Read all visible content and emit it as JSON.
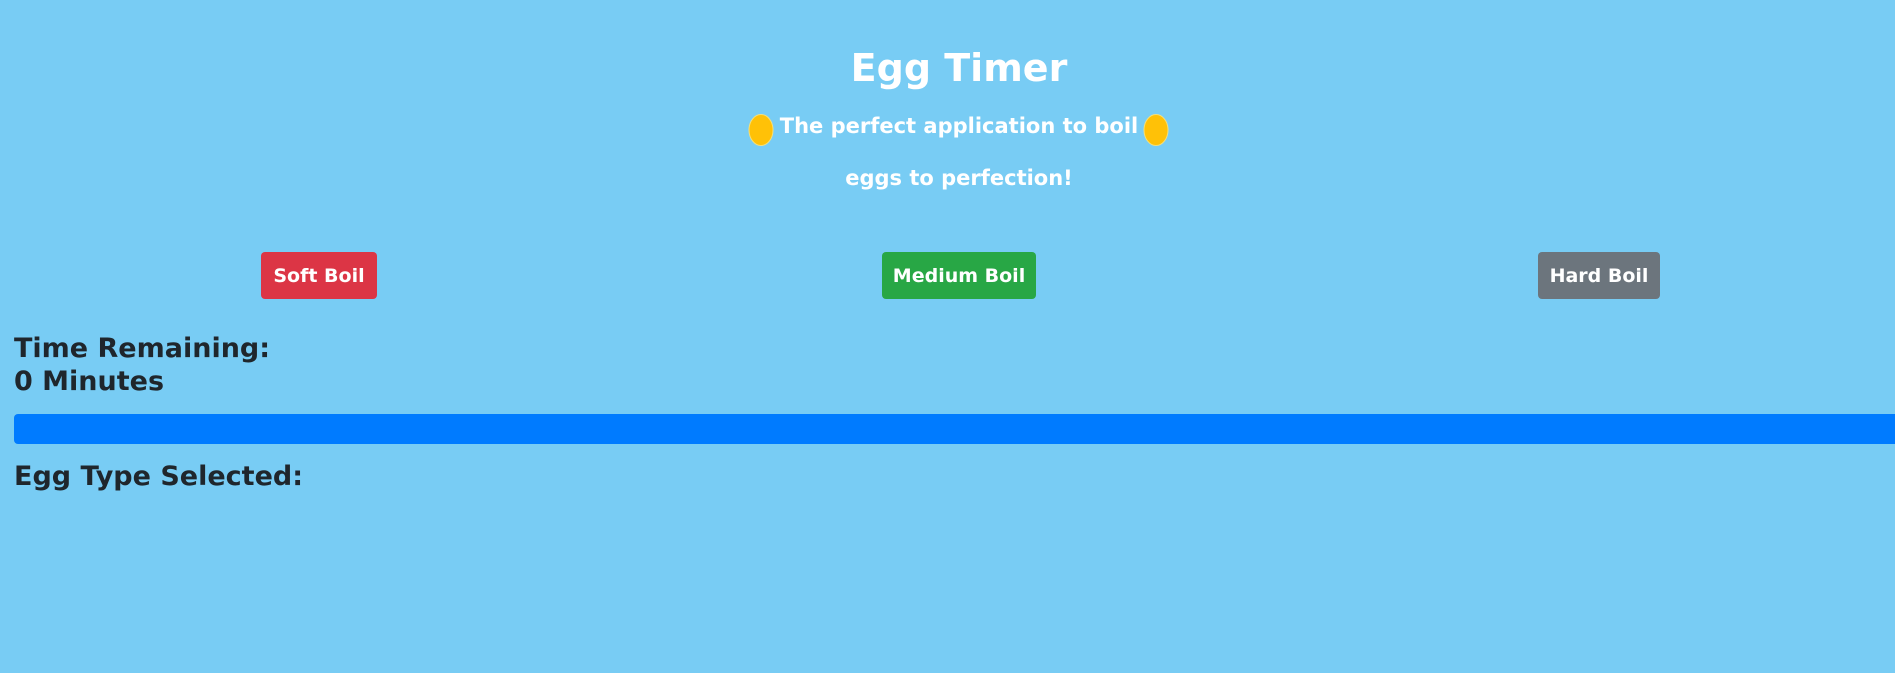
{
  "header": {
    "title": "Egg Timer",
    "tagline_line1": "The perfect application to boil",
    "tagline_line2": "eggs to perfection!",
    "egg_icon": "egg-icon",
    "egg_color": "#ffc107"
  },
  "buttons": {
    "soft": "Soft Boil",
    "medium": "Medium Boil",
    "hard": "Hard Boil"
  },
  "timer": {
    "time_label": "Time Remaining:",
    "minutes_value": "0 Minutes",
    "progress_percent": 100,
    "progress_color": "#007bff"
  },
  "egg_type": {
    "label": "Egg Type Selected:"
  },
  "colors": {
    "background": "#78ccf4",
    "soft": "#dc3545",
    "medium": "#28a745",
    "hard": "#6c757d"
  }
}
